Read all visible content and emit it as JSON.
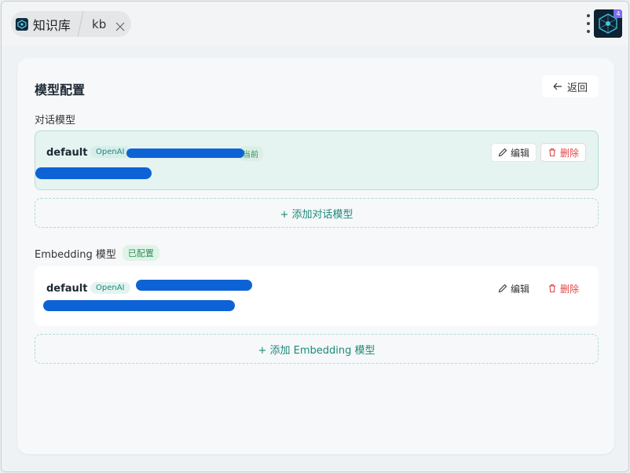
{
  "tabs": {
    "app_label": "知识库",
    "kb_label": "kb"
  },
  "header": {
    "avatar_badge": "4"
  },
  "page": {
    "title": "模型配置",
    "back_label": "返回"
  },
  "chat_section": {
    "title": "对话模型",
    "models": [
      {
        "name": "default",
        "provider": "OpenAI",
        "current_label": "当前",
        "edit_label": "编辑",
        "delete_label": "删除"
      }
    ],
    "add_label": "+ 添加对话模型"
  },
  "embedding_section": {
    "title": "Embedding 模型",
    "status": "已配置",
    "models": [
      {
        "name": "default",
        "provider": "OpenAI",
        "edit_label": "编辑",
        "delete_label": "删除"
      }
    ],
    "add_label": "+ 添加 Embedding 模型"
  },
  "colors": {
    "accent": "#1d8a7a",
    "danger": "#e04545",
    "redaction": "#0d63d6"
  }
}
